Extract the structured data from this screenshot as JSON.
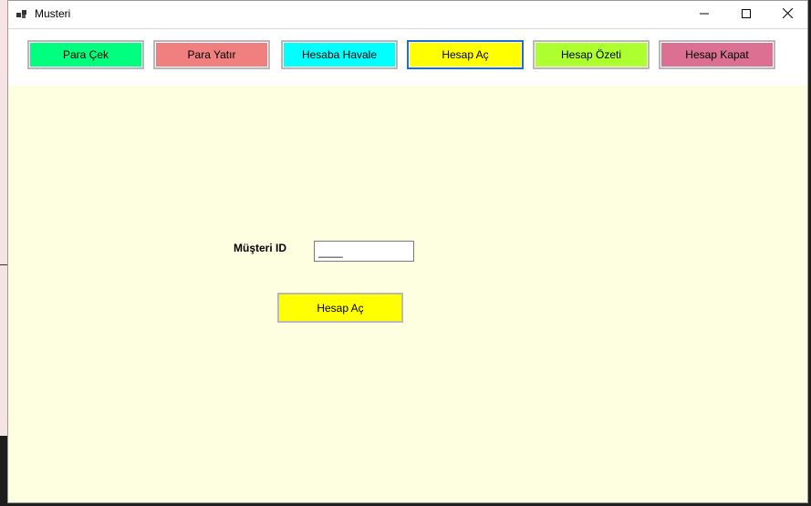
{
  "window": {
    "title": "Musteri"
  },
  "toolbar": {
    "buttons": [
      {
        "label": "Para Çek",
        "color": "#00ff7f"
      },
      {
        "label": "Para Yatır",
        "color": "#f08080"
      },
      {
        "label": "Hesaba Havale",
        "color": "#00ffff"
      },
      {
        "label": "Hesap Aç",
        "color": "#ffff00",
        "active": true
      },
      {
        "label": "Hesap Özeti",
        "color": "#adff2f"
      },
      {
        "label": "Hesap Kapat",
        "color": "#db7093"
      }
    ]
  },
  "form": {
    "id_label": "Müşteri ID",
    "id_value": "____",
    "submit_label": "Hesap Aç",
    "submit_color": "#ffff00",
    "background": "#fefee0"
  },
  "icons": {
    "app": "app-icon",
    "minimize": "minimize-icon",
    "maximize": "maximize-icon",
    "close": "close-icon"
  }
}
